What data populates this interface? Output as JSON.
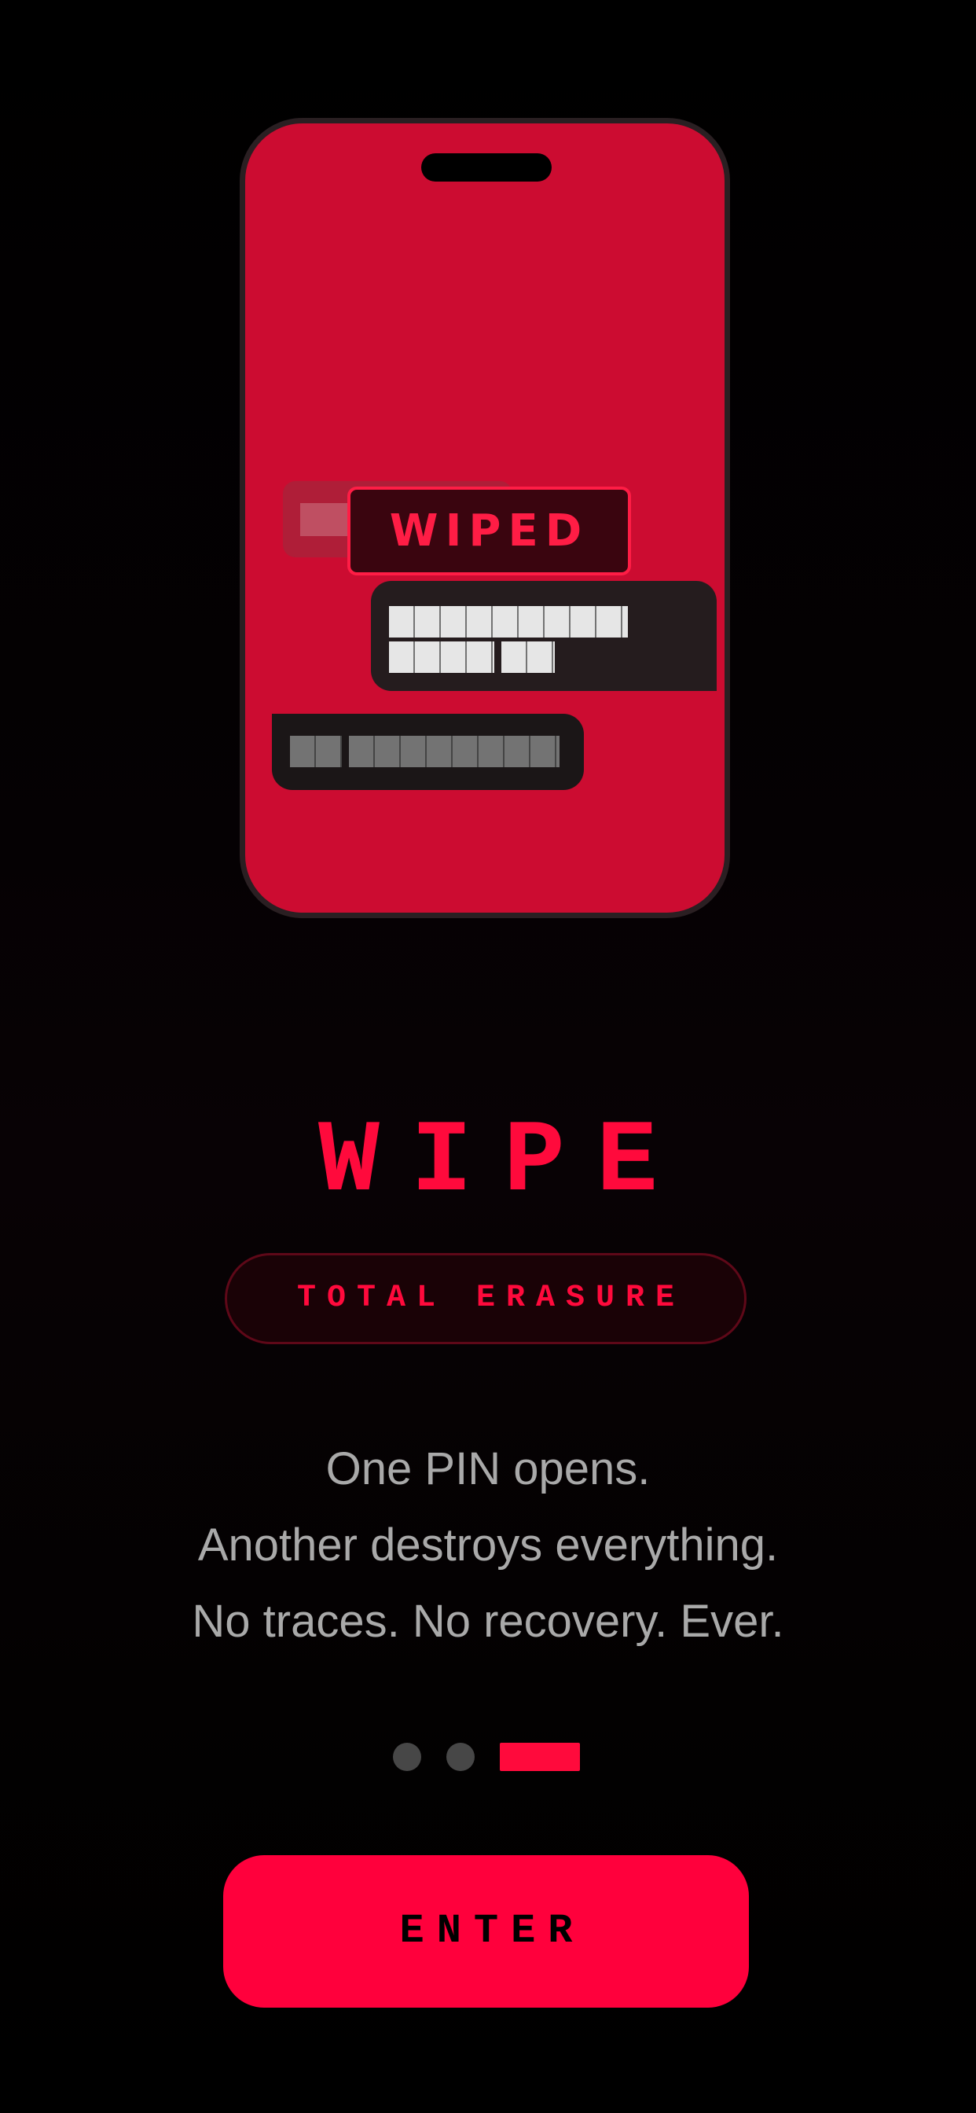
{
  "illustration": {
    "stamp_label": "WIPED"
  },
  "title": "WIPE",
  "badge": "TOTAL ERASURE",
  "description": {
    "line1": "One PIN opens.",
    "line2": "Another destroys everything.",
    "line3": "No traces. No recovery. Ever."
  },
  "pagination": {
    "total": 3,
    "current": 3
  },
  "enter_label": "ENTER",
  "colors": {
    "accent": "#ff0a3c",
    "phone_screen": "#cc0c31",
    "background": "#000000",
    "description_text": "#a9a9a9"
  }
}
